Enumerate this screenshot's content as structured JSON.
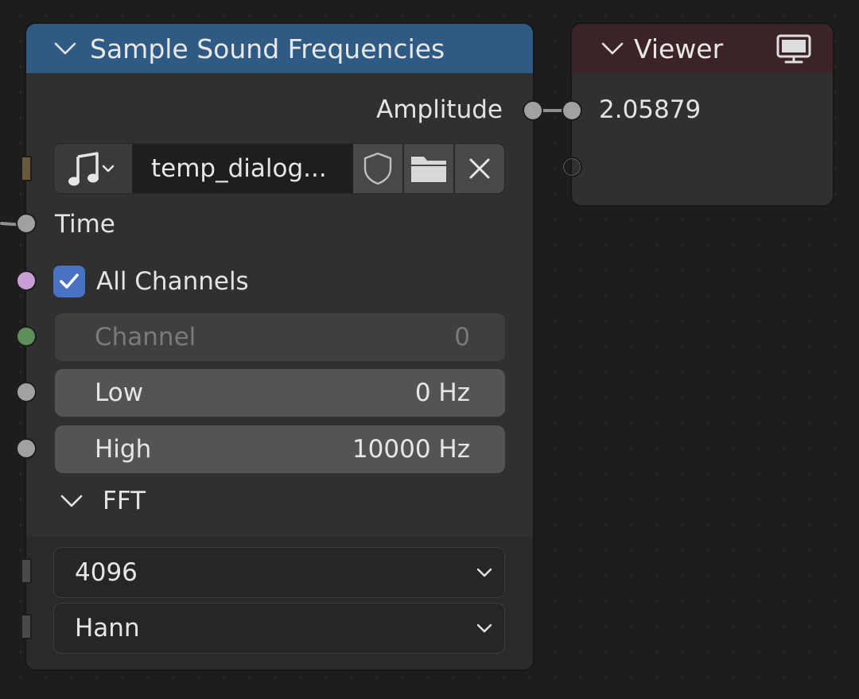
{
  "sample_node": {
    "title": "Sample Sound Frequencies",
    "header_color": "#2f5a83",
    "outputs": {
      "amplitude": "Amplitude"
    },
    "sound": {
      "filename": "temp_dialog...",
      "icons": [
        "music-note-icon",
        "shield-icon",
        "folder-icon",
        "close-icon"
      ]
    },
    "inputs": {
      "time": "Time",
      "all_channels": {
        "label": "All Channels",
        "checked": true
      },
      "channel": {
        "label": "Channel",
        "value": "0"
      },
      "low": {
        "label": "Low",
        "value": "0 Hz"
      },
      "high": {
        "label": "High",
        "value": "10000 Hz"
      }
    },
    "fft": {
      "label": "FFT",
      "size": "4096",
      "window": "Hann"
    }
  },
  "viewer_node": {
    "title": "Viewer",
    "header_color": "#3c2327",
    "value": "2.05879",
    "icon": "monitor-icon"
  }
}
